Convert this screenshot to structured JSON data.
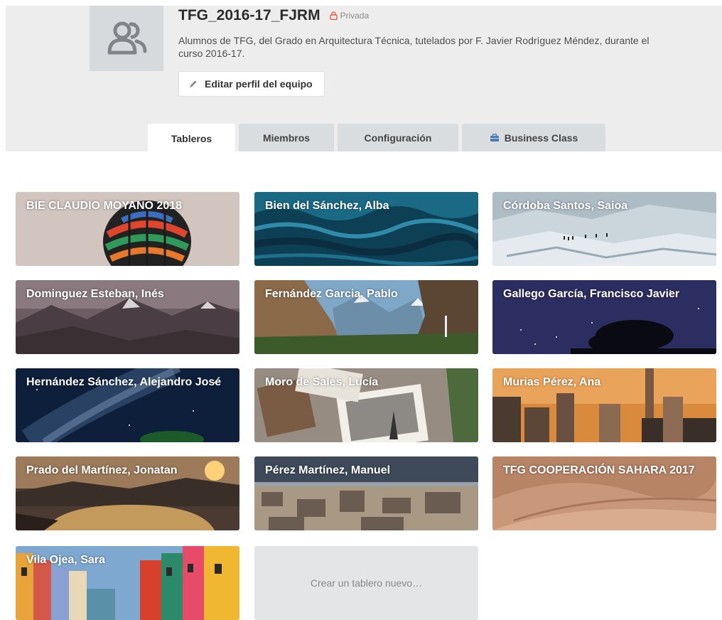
{
  "team": {
    "name": "TFG_2016-17_FJRM",
    "privacy": "Privada",
    "description": "Alumnos de TFG, del Grado en Arquitectura Técnica, tutelados por F. Javier Rodríguez Méndez, durante el curso 2016-17.",
    "edit_button": "Editar perfil del equipo"
  },
  "tabs": [
    {
      "label": "Tableros",
      "active": true
    },
    {
      "label": "Miembros",
      "active": false
    },
    {
      "label": "Configuración",
      "active": false
    },
    {
      "label": "Business Class",
      "active": false,
      "icon": "briefcase-icon"
    }
  ],
  "boards": [
    {
      "title": "BIE CLAUDIO MOYANO 2018",
      "background": "hot-air-balloon"
    },
    {
      "title": "Bien del Sánchez, Alba",
      "background": "ocean-waves"
    },
    {
      "title": "Córdoba Santos, Saioa",
      "background": "glacier"
    },
    {
      "title": "Dominguez Esteban, Inés",
      "background": "mountains"
    },
    {
      "title": "Fernández Garcia, Pablo",
      "background": "yosemite-valley"
    },
    {
      "title": "Gallego García, Francisco Javier",
      "background": "night-sky-tree"
    },
    {
      "title": "Hernández Sánchez, Alejandro José",
      "background": "milky-way"
    },
    {
      "title": "Moro de Sales, Lucía",
      "background": "photos-table"
    },
    {
      "title": "Murias Pérez, Ana",
      "background": "city-sunset"
    },
    {
      "title": "Prado del Martínez, Jonatan",
      "background": "lake-sunset"
    },
    {
      "title": "Pérez Martínez, Manuel",
      "background": "city-aerial"
    },
    {
      "title": "TFG COOPERACIÓN SAHARA 2017",
      "background": "desert-dunes"
    },
    {
      "title": "Vila Ojea, Sara",
      "background": "colorful-houses"
    }
  ],
  "create_board": "Crear un tablero nuevo…"
}
